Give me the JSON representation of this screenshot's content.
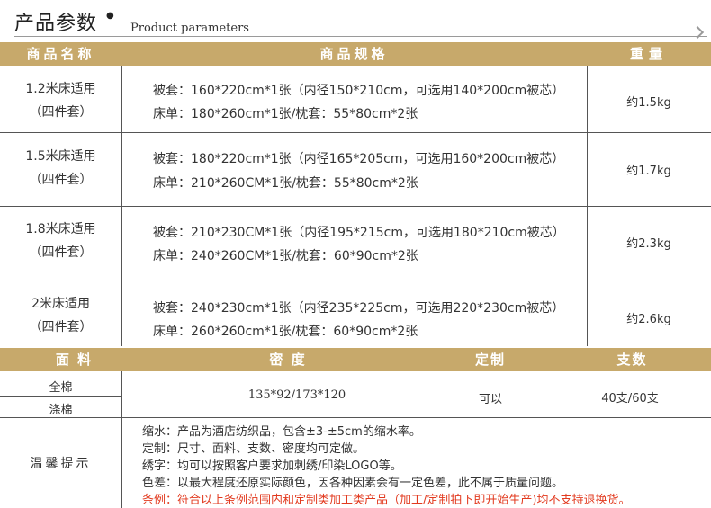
{
  "title": "产品参数",
  "title_dot": "●",
  "title_en": "Product parameters",
  "header": {
    "name": "商品名称",
    "spec": "商品规格",
    "weight": "重量"
  },
  "products": [
    {
      "bed": "1.2米床适用",
      "set": "（四件套）",
      "line1": "被套：160*220cm*1张（内径150*210cm，可选用140*200cm被芯）",
      "line2": "床单：180*260cm*1张/枕套：55*80cm*2张",
      "weight": "约1.5kg"
    },
    {
      "bed": "1.5米床适用",
      "set": "（四件套）",
      "line1": "被套：180*220cm*1张（内径165*205cm，可选用160*200cm被芯）",
      "line2": "床单：210*260CM*1张/枕套：55*80cm*2张",
      "weight": "约1.7kg"
    },
    {
      "bed": "1.8米床适用",
      "set": "（四件套）",
      "line1": "被套：210*230CM*1张（内径195*215cm，可选用180*210cm被芯）",
      "line2": "床单：240*260CM*1张/枕套：60*90cm*2张",
      "weight": "约2.3kg"
    },
    {
      "bed": "2米床适用",
      "set": "（四件套）",
      "line1": "被套：240*230cm*1张（内径235*225cm，可选用220*230cm被芯）",
      "line2": "床单：260*260cm*1张/枕套：60*90cm*2张",
      "weight": "约2.6kg"
    }
  ],
  "fabric_header": {
    "fabric": "面 料",
    "density": "密 度",
    "custom": "定制",
    "count": "支数"
  },
  "fabric": {
    "types": [
      "全棉",
      "涤棉"
    ],
    "density": "135*92/173*120",
    "custom": "可以",
    "count": "40支/60支"
  },
  "tips": {
    "label": "温馨提示",
    "lines": [
      "缩水：产品为酒店纺织品，包含±3-±5cm的缩水率。",
      "定制：尺寸、面料、支数、密度均可定做。",
      "绣字：均可以按照客户要求加刺绣/印染LOGO等。",
      "色差：以最大程度还原实际颜色，因各种因素会有一定色差，此不属于质量问题。"
    ],
    "warning": "条例：符合以上条例范围内和定制类加工类产品（加工/定制拍下即开始生产)均不支持退换货。",
    "warning_color": "#e23a1f"
  },
  "colors": {
    "gold": "#c7a96b"
  }
}
